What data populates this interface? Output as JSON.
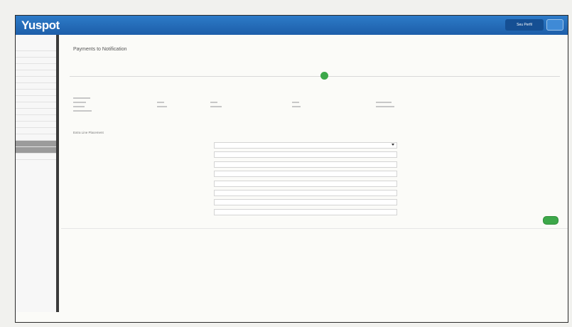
{
  "app": {
    "logo": "Yuspot"
  },
  "topbar": {
    "user_button": "Seu Perfil",
    "menu_button": ""
  },
  "sidebar": {
    "items": [
      {
        "label": "",
        "active": false
      },
      {
        "label": "",
        "active": false
      },
      {
        "label": "",
        "active": false
      },
      {
        "label": "",
        "active": false
      },
      {
        "label": "",
        "active": false
      },
      {
        "label": "",
        "active": false
      },
      {
        "label": "",
        "active": false
      },
      {
        "label": "",
        "active": false
      },
      {
        "label": "",
        "active": false
      },
      {
        "label": "",
        "active": false
      },
      {
        "label": "",
        "active": false
      },
      {
        "label": "",
        "active": false
      },
      {
        "label": "",
        "active": false
      },
      {
        "label": "",
        "active": false
      },
      {
        "label": "",
        "active": false
      },
      {
        "label": "",
        "active": true
      },
      {
        "label": "",
        "active": true
      },
      {
        "label": "",
        "active": false
      }
    ]
  },
  "main": {
    "title": "Payments to Notification",
    "steps": [
      {
        "label": "",
        "current": false
      },
      {
        "label": "",
        "current": true
      },
      {
        "label": "",
        "current": false
      }
    ],
    "section1_title": "",
    "section2_title": "Extra Line Placement",
    "form": {
      "fields": [
        {
          "label": "",
          "value": "",
          "type": "select"
        },
        {
          "label": "",
          "value": "",
          "type": "text"
        },
        {
          "label": "",
          "value": "",
          "type": "text"
        },
        {
          "label": "",
          "value": "",
          "type": "text"
        },
        {
          "label": "",
          "value": "",
          "type": "text"
        },
        {
          "label": "",
          "value": "",
          "type": "text"
        },
        {
          "label": "",
          "value": "",
          "type": "text"
        },
        {
          "label": "",
          "value": "",
          "type": "text"
        }
      ]
    },
    "save_button": "",
    "footer_note": ""
  },
  "colors": {
    "topbar": "#2163ad",
    "accent_green": "#3da84a",
    "sidebar_active": "#9b9b9b"
  }
}
